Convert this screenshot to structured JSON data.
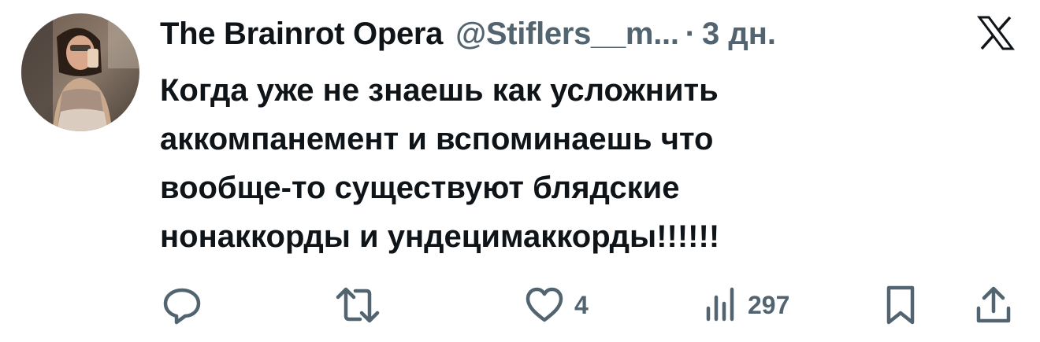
{
  "tweet": {
    "author_name": "The Brainrot Opera",
    "handle": "@Stiflers__m...",
    "separator": "·",
    "time": "3 дн.",
    "text": "Когда уже не знаешь как усложнить\nаккомпанемент и вспоминаешь что\nвообще-то существуют блядские\nнонаккорды и ундецимаккорды!!!!!!"
  },
  "actions": {
    "like_count": "4",
    "views_count": "297"
  },
  "colors": {
    "text_primary": "#0f1419",
    "text_secondary": "#536471",
    "background": "#ffffff"
  },
  "icons": [
    "avatar",
    "x-logo-icon",
    "reply-icon",
    "retweet-icon",
    "like-icon",
    "views-icon",
    "bookmark-icon",
    "share-icon"
  ]
}
